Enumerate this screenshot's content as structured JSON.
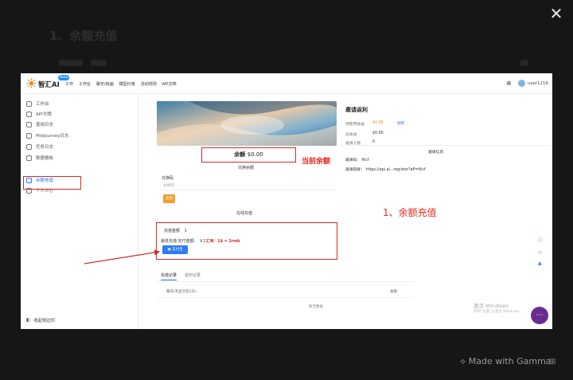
{
  "background": {
    "doc_title": "1、余额充值",
    "gamma_badge": "Made with Gamma",
    "close_icon": "close-icon"
  },
  "app": {
    "brand": "智汇AI",
    "beta": "Beta",
    "nav": [
      "工作",
      "工作台",
      "聊天/绘画",
      "模型价格",
      "活动规则",
      "API文档"
    ],
    "user": "user1216"
  },
  "sidebar": {
    "items": [
      {
        "label": "工作台",
        "icon": "dashboard-icon"
      },
      {
        "label": "API令牌",
        "icon": "key-icon"
      },
      {
        "label": "使用日志",
        "icon": "log-icon"
      },
      {
        "label": "Midjourney日志",
        "icon": "image-icon"
      },
      {
        "label": "任务日志",
        "icon": "task-icon"
      },
      {
        "label": "数据看板",
        "icon": "chart-icon"
      },
      {
        "label": "余额充值",
        "icon": "wallet-icon",
        "active": true
      },
      {
        "label": "个人中心",
        "icon": "user-icon"
      }
    ],
    "collapse_label": "收起侧边栏"
  },
  "wallet": {
    "balance_label": "余额",
    "balance_value": "$0.00",
    "current_balance_annotation": "当前余额",
    "redeem_section_title": "兑换余额",
    "redeem_label": "兑换码",
    "redeem_placeholder": "兑换码",
    "redeem_button": "兑换",
    "online_section_title": "在线充值",
    "topup_amount_label": "充值金额",
    "topup_amount_value": "1",
    "pay_method_label": "最低充值 实付金额：",
    "pay_amount": "￥2",
    "exchange_note": "汇率：1$ = 2rmb",
    "pay_button": "支付宝",
    "tabs": [
      "充值记录",
      "返利记录"
    ],
    "table_col_a": "都有(有显示后3天)",
    "table_col_b": "金额",
    "no_data": "暂无数据"
  },
  "invite": {
    "title": "邀请返利",
    "rows": [
      {
        "label": "待使用收益",
        "value": "$0.00"
      },
      {
        "label": "总收益",
        "value": "$0.00"
      },
      {
        "label": "邀请人数",
        "value": "0"
      }
    ],
    "transfer_link": "划转",
    "aff_title": "邀请信息",
    "aff_code_label": "邀请码：",
    "aff_code_value": "fkcf",
    "aff_link_label": "邀请链接：",
    "aff_link_value": "https://api.ai...register?aff=fkcf"
  },
  "annotations": {
    "recharge": "1、余额充值",
    "annotation_color": "#e8281e"
  },
  "watermark": {
    "line1": "激活 Windows",
    "line2": "转到\"设置\"以激活 Windows。"
  }
}
